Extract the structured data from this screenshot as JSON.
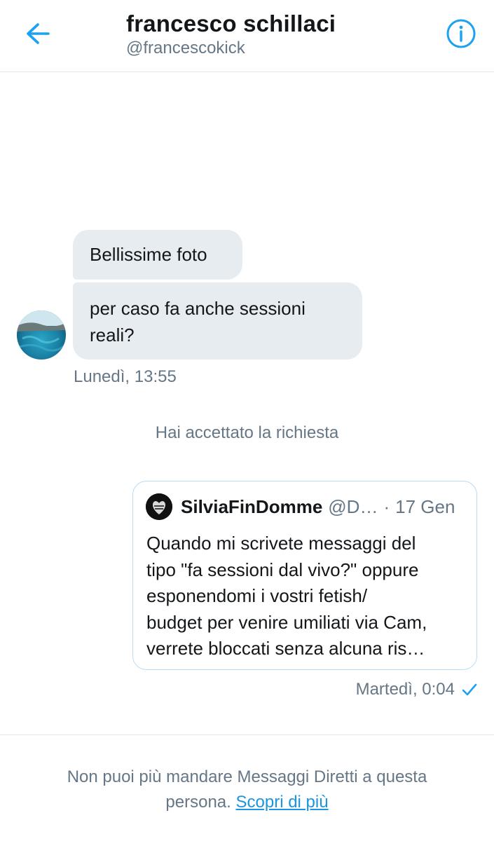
{
  "header": {
    "title": "francesco schillaci",
    "handle": "@francescokick",
    "back_icon": "arrow-left-icon",
    "info_icon": "info-icon",
    "accent_color": "#1da1f2"
  },
  "conversation": {
    "incoming": [
      {
        "text": "Bellissime foto"
      },
      {
        "lines": [
          "per caso fa anche sessioni",
          "reali?"
        ]
      }
    ],
    "incoming_timestamp": "Lunedì, 13:55",
    "system_message": "Hai accettato la richiesta",
    "shared_tweet": {
      "author_name": "SilviaFinDomme",
      "author_handle": "@D…",
      "separator": "·",
      "date": "17 Gen",
      "lines": [
        "Quando mi scrivete messaggi del",
        "tipo \"fa sessioni dal vivo?\" oppure",
        "esponendomi i vostri fetish/",
        "budget per venire umiliati via Cam,",
        "verrete bloccati senza alcuna ris…"
      ]
    },
    "outgoing_timestamp": "Martedì, 0:04",
    "status_icon": "checkmark-icon"
  },
  "footer": {
    "line1": "Non puoi più mandare Messaggi Diretti a questa",
    "line2_prefix": "persona.",
    "link_text": "Scopri di più"
  }
}
